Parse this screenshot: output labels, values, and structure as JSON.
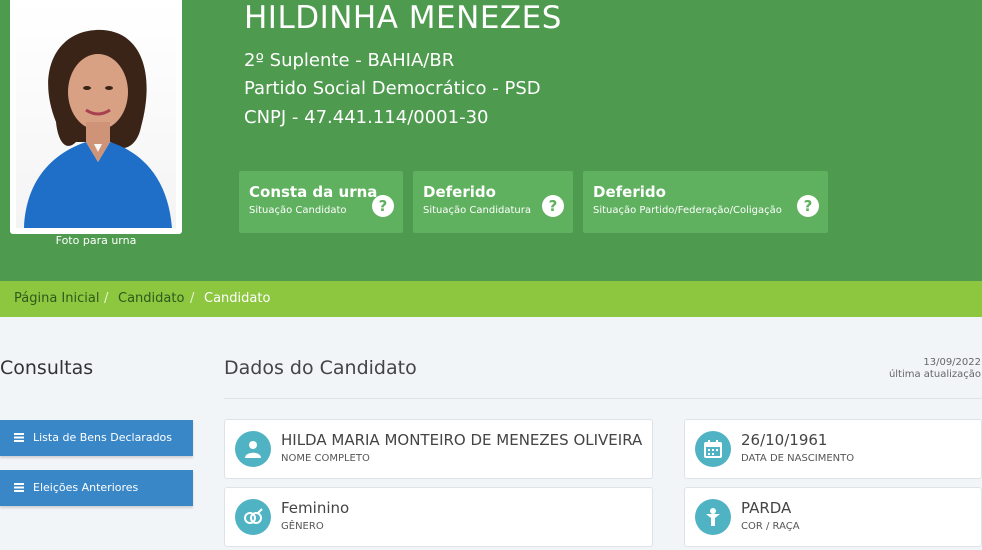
{
  "candidate": {
    "name": "HILDINHA MENEZES",
    "position": "2º Suplente - BAHIA/BR",
    "party": "Partido Social Democrático - PSD",
    "cnpj": "CNPJ - 47.441.114/0001-30",
    "photo_caption": "Foto para urna"
  },
  "status": [
    {
      "title": "Consta da urna",
      "subtitle": "Situação Candidato"
    },
    {
      "title": "Deferido",
      "subtitle": "Situação Candidatura"
    },
    {
      "title": "Deferido",
      "subtitle": "Situação Partido/Federação/Coligação"
    }
  ],
  "breadcrumb": {
    "home": "Página Inicial",
    "sep": "/",
    "candidate": "Candidato",
    "current": "Candidato"
  },
  "sidebar": {
    "title": "Consultas",
    "buttons": [
      {
        "label": "Lista de Bens Declarados",
        "icon": "list-icon"
      },
      {
        "label": "Eleições Anteriores",
        "icon": "list-icon"
      }
    ]
  },
  "main": {
    "title": "Dados do Candidato",
    "update_date": "13/09/2022",
    "update_label": "última atualização",
    "fields": [
      {
        "value": "HILDA MARIA MONTEIRO DE MENEZES OLIVEIRA",
        "label": "NOME COMPLETO",
        "icon": "user-icon"
      },
      {
        "value": "26/10/1961",
        "label": "DATA DE NASCIMENTO",
        "icon": "calendar-icon"
      },
      {
        "value": "Feminino",
        "label": "GÊNERO",
        "icon": "gender-icon"
      },
      {
        "value": "PARDA",
        "label": "COR / RAÇA",
        "icon": "person-icon"
      }
    ]
  },
  "colors": {
    "header": "#4e9a4e",
    "status_box": "#5fb15f",
    "breadcrumb": "#8dc63f",
    "button": "#3a87c8",
    "icon_circle": "#4fb3c4"
  }
}
